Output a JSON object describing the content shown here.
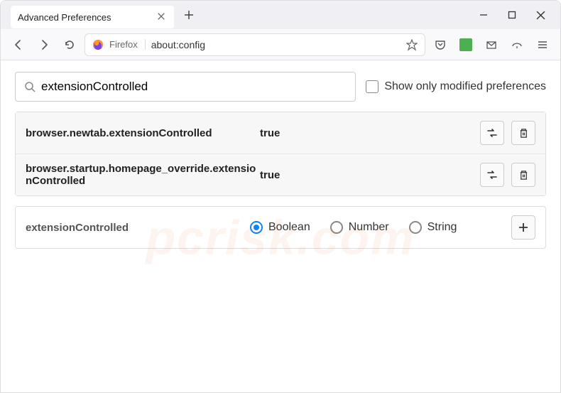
{
  "tab": {
    "title": "Advanced Preferences"
  },
  "address": {
    "label": "Firefox",
    "url": "about:config"
  },
  "search": {
    "value": "extensionControlled"
  },
  "checkbox": {
    "label": "Show only modified preferences",
    "checked": false
  },
  "prefs": [
    {
      "name": "browser.newtab.extensionControlled",
      "value": "true"
    },
    {
      "name": "browser.startup.homepage_override.extensionControlled",
      "value": "true"
    }
  ],
  "new_pref": {
    "name": "extensionControlled",
    "types": [
      "Boolean",
      "Number",
      "String"
    ],
    "selected": "Boolean"
  },
  "watermark": "pcrisk.com"
}
